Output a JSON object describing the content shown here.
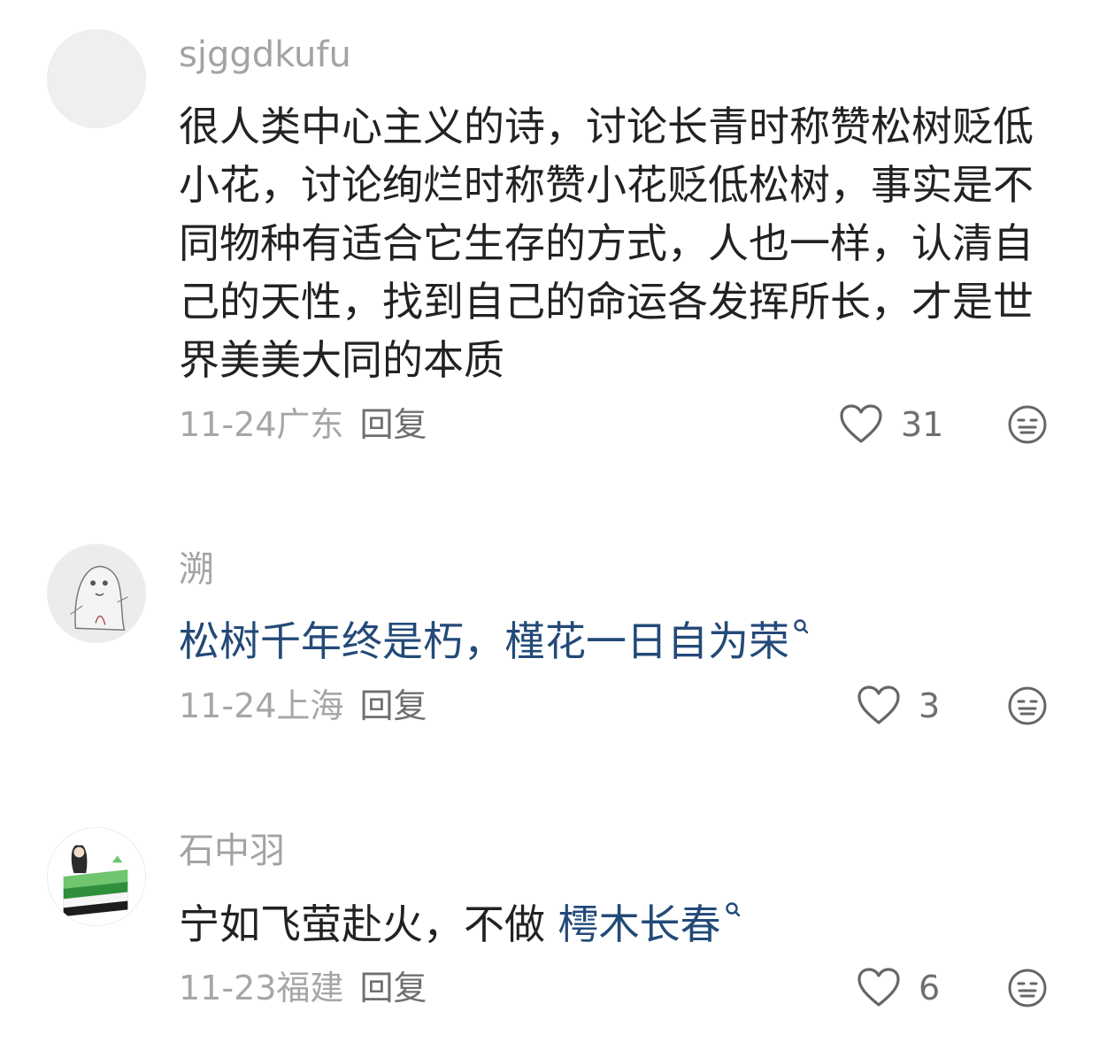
{
  "comments": [
    {
      "username": "sjggdkufu",
      "text": "很人类中心主义的诗，讨论长青时称赞松树贬低小花，讨论绚烂时称赞小花贬低松树，事实是不同物种有适合它生存的方式，人也一样，认清自己的天性，找到自己的命运各发挥所长，才是世界美美大同的本质",
      "date": "11-24",
      "location": "广东",
      "reply_label": "回复",
      "likes": "31"
    },
    {
      "username": "溯",
      "text": "松树千年终是朽，槿花一日自为荣",
      "date": "11-24",
      "location": "上海",
      "reply_label": "回复",
      "likes": "3"
    },
    {
      "username": "石中羽",
      "text_prefix": "宁如飞萤赴火，不做 ",
      "text_link": "樗木长春",
      "date": "11-23",
      "location": "福建",
      "reply_label": "回复",
      "likes": "6"
    }
  ],
  "icons": {
    "like": "heart-outline-icon",
    "dislike": "neutral-face-icon",
    "search_hint": "search-icon"
  },
  "colors": {
    "link": "#234a78",
    "username": "#a3a3a3",
    "body_text": "#222222",
    "meta": "#a6a6a6"
  }
}
